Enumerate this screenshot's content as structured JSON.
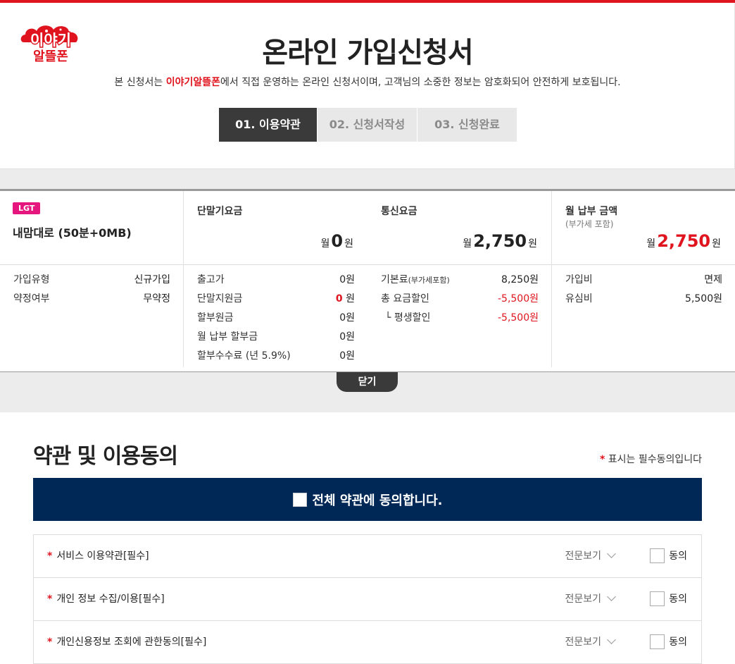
{
  "header": {
    "logo_text": "이야기 알뜰폰",
    "title": "온라인 가입신청서",
    "subtitle_prefix": "본 신청서는 ",
    "subtitle_brand": "이야기알뜰폰",
    "subtitle_suffix": "에서 직접 운영하는 온라인 신청서이며, 고객님의 소중한 정보는 암호화되어 안전하게 보호됩니다.",
    "steps": [
      "01. 이용약관",
      "02. 신청서작성",
      "03. 신청완료"
    ]
  },
  "summary": {
    "plan": {
      "badge": "LGT",
      "name": "내맘대로 (50분+0MB)",
      "rows": [
        {
          "k": "가입유형",
          "v": "신규가입"
        },
        {
          "k": "약정여부",
          "v": "무약정"
        }
      ]
    },
    "device": {
      "title": "단말기요금",
      "price_prefix": "월",
      "price_value": "0",
      "price_unit": "원",
      "rows": [
        {
          "k": "출고가",
          "v": "0원"
        },
        {
          "k": "단말지원금",
          "v_red": "0",
          "v_unit": " 원"
        },
        {
          "k": "할부원금",
          "v": "0원"
        },
        {
          "k": "월 납부 할부금",
          "v": "0원"
        },
        {
          "k": "할부수수료 (년 5.9%)",
          "v": "0원"
        }
      ]
    },
    "telecom": {
      "title": "통신요금",
      "price_prefix": "월",
      "price_value": "2,750",
      "price_unit": "원",
      "rows": [
        {
          "k": "기본료",
          "k_small": "(부가세포함)",
          "v": "8,250원"
        },
        {
          "k": "총 요금할인",
          "v": "-5,500원"
        },
        {
          "k": "└ 평생할인",
          "v": "-5,500원"
        }
      ]
    },
    "monthly": {
      "title": "월 납부 금액",
      "sub": "(부가세 포함)",
      "price_prefix": "월",
      "price_value": "2,750",
      "price_unit": "원",
      "rows": [
        {
          "k": "가입비",
          "v": "면제"
        },
        {
          "k": "유심비",
          "v": "5,500원"
        }
      ]
    },
    "close_label": "닫기"
  },
  "terms": {
    "title": "약관 및 이용동의",
    "required_star": "*",
    "required_note": "표시는 필수동의입니다",
    "agree_all": "전체 약관에 동의합니다.",
    "view_label": "전문보기",
    "agree_label": "동의",
    "items": [
      {
        "label": "서비스 이용약관[필수]"
      },
      {
        "label": "개인 정보 수집/이용[필수]"
      },
      {
        "label": "개인신용정보 조회에 관한동의[필수]"
      }
    ]
  },
  "colors": {
    "brand_red": "#e0141e",
    "navy": "#002857",
    "badge_pink": "#e5177e",
    "step_active": "#3a3a3a"
  }
}
